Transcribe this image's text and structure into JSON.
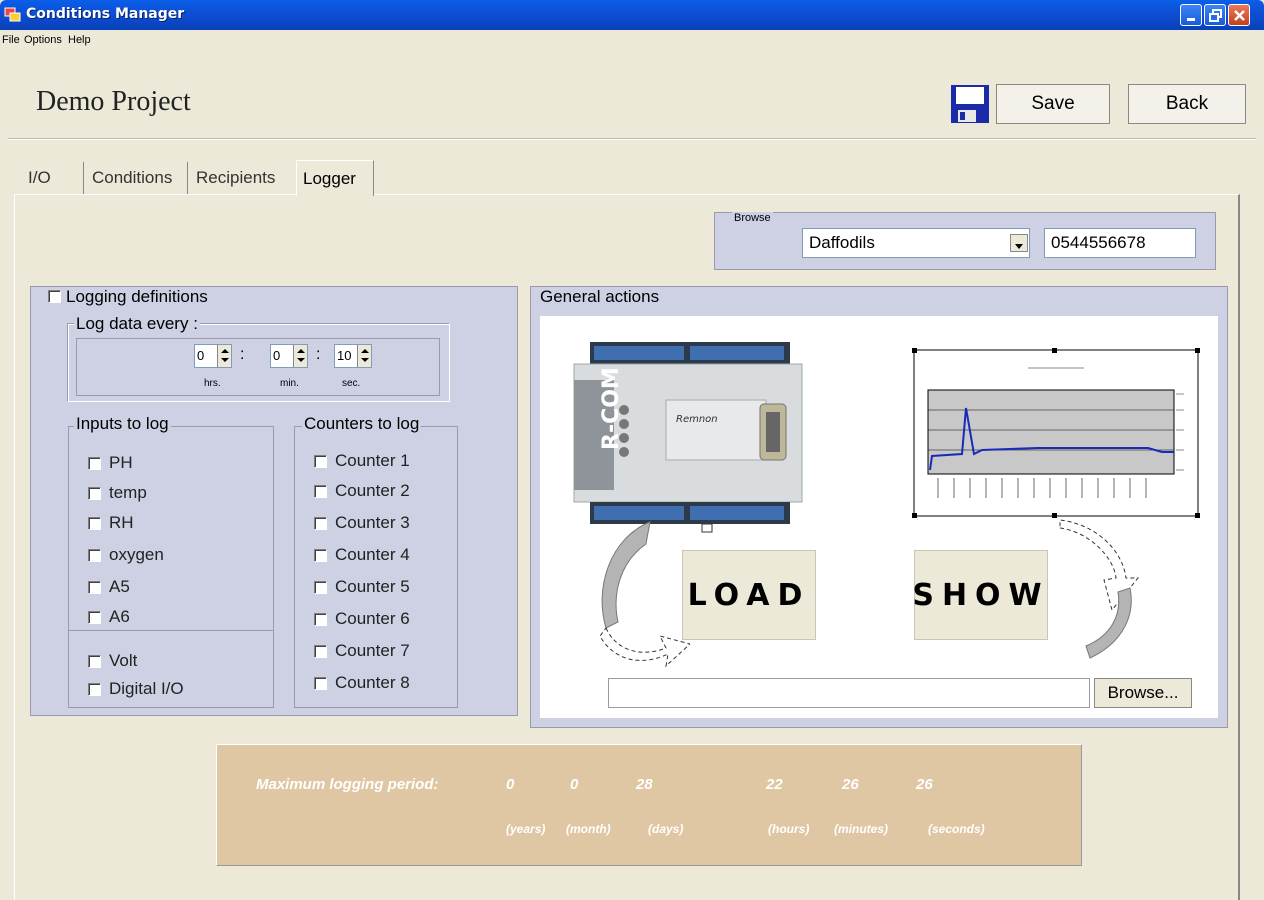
{
  "window": {
    "title": "Conditions Manager"
  },
  "menu": {
    "items": [
      "File",
      "Options",
      "Help"
    ]
  },
  "header": {
    "project_title": "Demo Project",
    "save_label": "Save",
    "back_label": "Back"
  },
  "tabs": [
    {
      "label": "I/O",
      "active": false
    },
    {
      "label": "Conditions",
      "active": false
    },
    {
      "label": "Recipients",
      "active": false
    },
    {
      "label": "Logger",
      "active": true
    }
  ],
  "browse": {
    "legend": "Browse",
    "selected_site": "Daffodils",
    "phone": "0544556678"
  },
  "logging_definitions": {
    "label": "Logging definitions",
    "checked": false,
    "log_every": {
      "legend": "Log data every :",
      "hours": "0",
      "minutes": "0",
      "seconds": "10",
      "hours_unit": "hrs.",
      "minutes_unit": "min.",
      "seconds_unit": "sec."
    },
    "inputs": {
      "legend": "Inputs to log",
      "items": [
        "PH",
        "temp",
        "RH",
        "oxygen",
        "A5",
        "A6",
        "Volt",
        "Digital I/O"
      ]
    },
    "counters": {
      "legend": "Counters to log",
      "items": [
        "Counter 1",
        "Counter 2",
        "Counter 3",
        "Counter 4",
        "Counter 5",
        "Counter 6",
        "Counter 7",
        "Counter 8"
      ]
    }
  },
  "general_actions": {
    "legend": "General actions",
    "load_label": "LOAD",
    "show_label": "SHOW",
    "file_path": "",
    "browse_button": "Browse..."
  },
  "max_logging": {
    "label": "Maximum logging period:",
    "values": [
      {
        "value": "0",
        "unit": "(years)"
      },
      {
        "value": "0",
        "unit": "(month)"
      },
      {
        "value": "28",
        "unit": "(days)"
      },
      {
        "value": "22",
        "unit": "(hours)"
      },
      {
        "value": "26",
        "unit": "(minutes)"
      },
      {
        "value": "26",
        "unit": "(seconds)"
      }
    ]
  },
  "colors": {
    "titlebar": "#0a5fe8",
    "group_bg": "#cdd1e3",
    "max_bg": "#e0c7a3"
  }
}
